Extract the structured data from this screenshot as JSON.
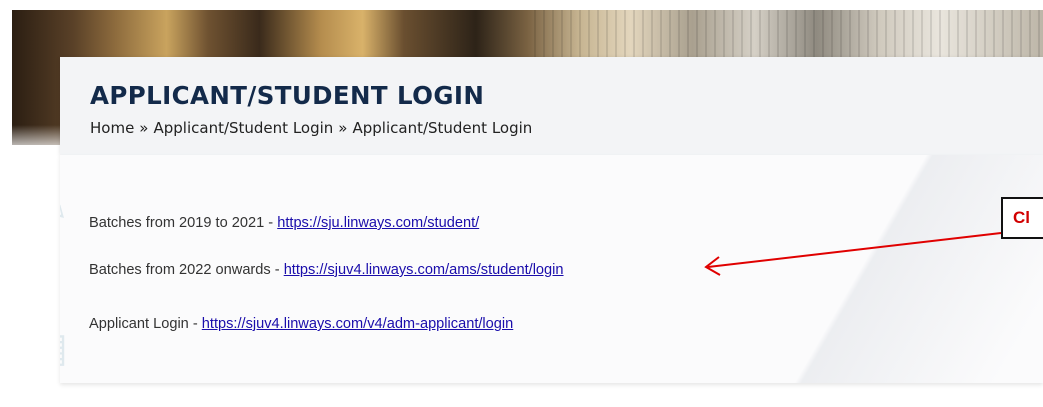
{
  "header": {
    "title": "APPLICANT/STUDENT LOGIN",
    "breadcrumb": [
      "Home",
      "Applicant/Student Login",
      "Applicant/Student Login"
    ],
    "separator": "»"
  },
  "content": {
    "lines": [
      {
        "label": "Batches from 2019 to 2021 - ",
        "link": "https://sju.linways.com/student/"
      },
      {
        "label": "Batches from 2022 onwards - ",
        "link": "https://sjuv4.linways.com/ams/student/login"
      },
      {
        "label": "Applicant Login - ",
        "link": "https://sjuv4.linways.com/v4/adm-applicant/login"
      }
    ]
  },
  "annotation": {
    "text": "Cl",
    "color": "#d10000"
  },
  "colors": {
    "title": "#132a4a",
    "link": "#1a0dab",
    "arrow": "#e00000"
  }
}
